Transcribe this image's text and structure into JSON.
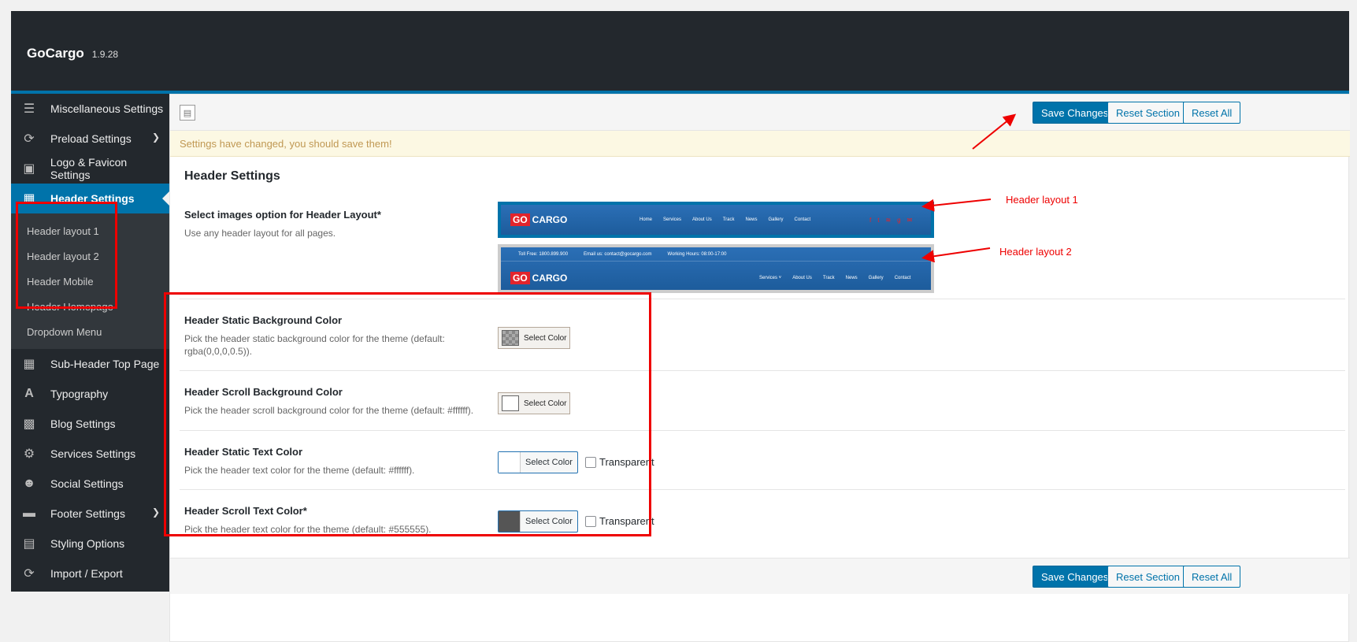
{
  "app": {
    "title": "GoCargo",
    "version": "1.9.28"
  },
  "sidebar": {
    "items": [
      {
        "label": "Miscellaneous Settings",
        "icon": "stack-icon"
      },
      {
        "label": "Preload Settings",
        "icon": "refresh-icon"
      },
      {
        "label": "Logo & Favicon Settings",
        "icon": "image-icon"
      },
      {
        "label": "Header Settings",
        "icon": "qr-grid-icon"
      },
      {
        "label": "Sub-Header Top Page",
        "icon": "qr-grid-icon"
      },
      {
        "label": "Typography",
        "icon": "font-icon"
      },
      {
        "label": "Blog Settings",
        "icon": "blog-icon"
      },
      {
        "label": "Services Settings",
        "icon": "gears-icon"
      },
      {
        "label": "Social Settings",
        "icon": "users-icon"
      },
      {
        "label": "Footer Settings",
        "icon": "card-icon"
      },
      {
        "label": "Styling Options",
        "icon": "window-icon"
      },
      {
        "label": "Import / Export",
        "icon": "refresh-icon"
      }
    ],
    "submenu": [
      "Header layout 1",
      "Header layout 2",
      "Header Mobile",
      "Header Homepage",
      "Dropdown Menu"
    ]
  },
  "toolbar": {
    "save": "Save Changes",
    "reset_section": "Reset Section",
    "reset_all": "Reset All"
  },
  "notice": "Settings have changed, you should save them!",
  "section_title": "Header Settings",
  "layout_option": {
    "title": "Select images option for Header Layout*",
    "desc": "Use any header layout for all pages."
  },
  "preview": {
    "logo_go": "GO",
    "logo_text": "CARGO",
    "nav1": [
      "Home",
      "Services",
      "About Us",
      "Track",
      "News",
      "Gallery",
      "Contact"
    ],
    "nav2": [
      "Services ˅",
      "About Us",
      "Track",
      "News",
      "Gallery",
      "Contact"
    ],
    "strip": [
      "Toll Free: 1800.899.900",
      "Email us: contact@gocargo.com",
      "Working Hours: 08:00-17:00"
    ]
  },
  "annotations": {
    "layout1": "Header layout 1",
    "layout2": "Header layout 2"
  },
  "options": [
    {
      "title": "Header Static Background Color",
      "desc": "Pick the header static background color for the theme (default: rgba(0,0,0,0.5)).",
      "button": "Select Color"
    },
    {
      "title": "Header Scroll Background Color",
      "desc": "Pick the header scroll background color for the theme (default: #ffffff).",
      "button": "Select Color"
    },
    {
      "title": "Header Static Text Color",
      "desc": "Pick the header text color for the theme (default: #ffffff).",
      "button": "Select Color",
      "checkbox": "Transparent"
    },
    {
      "title": "Header Scroll Text Color*",
      "desc": "Pick the header text color for the theme (default: #555555).",
      "button": "Select Color",
      "checkbox": "Transparent"
    }
  ],
  "colors": {
    "accent": "#0073aa",
    "sidebar": "#23282d",
    "highlight": "#ee0000",
    "brand_red": "#e2242c",
    "scroll_text": "#555555"
  }
}
